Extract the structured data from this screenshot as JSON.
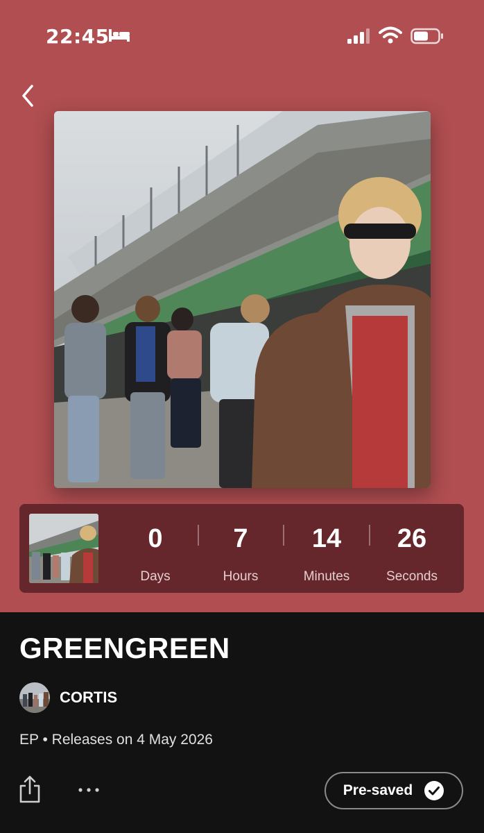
{
  "status_bar": {
    "time": "22:45",
    "icons": [
      "bed-icon",
      "signal-icon",
      "wifi-icon",
      "battery-icon"
    ]
  },
  "nav": {
    "back_icon": "back-icon"
  },
  "colors": {
    "hero_background": "#b04e51",
    "countdown_background": "#65272b",
    "page_background": "#121212"
  },
  "countdown": {
    "units": [
      {
        "value": "0",
        "label": "Days"
      },
      {
        "value": "7",
        "label": "Hours"
      },
      {
        "value": "14",
        "label": "Minutes"
      },
      {
        "value": "26",
        "label": "Seconds"
      }
    ]
  },
  "album": {
    "title": "GREENGREEN",
    "artist": "CORTIS",
    "release_info": "EP • Releases on 4 May 2026"
  },
  "actions": {
    "share_icon": "share-icon",
    "more_icon": "more-icon",
    "presave_label": "Pre-saved",
    "presave_icon": "check-circle-icon"
  }
}
